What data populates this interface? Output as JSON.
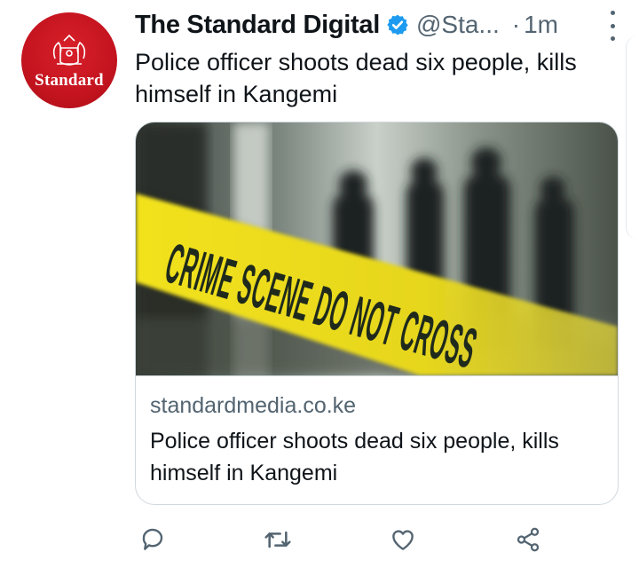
{
  "tweet": {
    "author_name": "The Standard Digital",
    "handle": "@Sta...",
    "separator": "·",
    "time": "1m",
    "text": "Police officer shoots dead six people, kills himself in Kangemi"
  },
  "avatar": {
    "label": "Standard",
    "bg_color": "#c4141f"
  },
  "card": {
    "image_tape_text": "CRIME SCENE DO NOT CROSS",
    "domain": "standardmedia.co.ke",
    "title": "Police officer shoots dead six people, kills himself in Kangemi"
  },
  "actions": [
    {
      "name": "reply",
      "icon": "speech-bubble-icon"
    },
    {
      "name": "retweet",
      "icon": "retweet-icon"
    },
    {
      "name": "like",
      "icon": "heart-icon"
    },
    {
      "name": "share",
      "icon": "share-icon"
    }
  ],
  "colors": {
    "verified": "#1d9bf0",
    "secondary_text": "#536471",
    "tape_yellow": "#f2e21a",
    "border": "#cfd9de"
  }
}
